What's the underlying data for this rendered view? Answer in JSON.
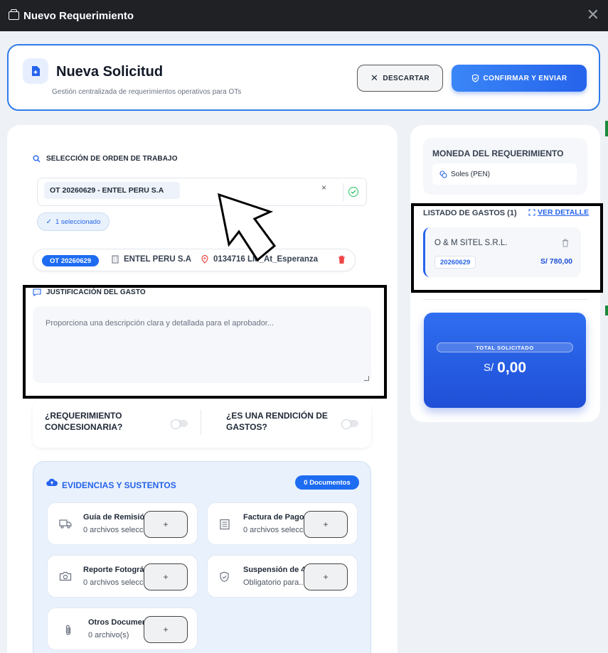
{
  "window": {
    "title": "Nuevo Requerimiento",
    "close_glyph": "✕"
  },
  "header": {
    "title": "Nueva Solicitud",
    "subtitle": "Gestión centralizada de requerimientos operativos para OTs",
    "discard_label": "DESCARTAR",
    "confirm_label": "CONFIRMAR Y ENVIAR"
  },
  "work_order": {
    "section_label": "SELECCIÓN DE ORDEN DE TRABAJO",
    "selected_chip": "OT 20260629 - ENTEL PERU S.A",
    "clear_glyph": "×",
    "selected_count": "1 seleccionado",
    "row": {
      "ot_tag": "OT 20260629",
      "company": "ENTEL PERU S.A",
      "location": "0134716 LM_At_Esperanza"
    }
  },
  "justification": {
    "section_label": "JUSTIFICACIÓN DEL GASTO",
    "placeholder": "Proporciona una descripción clara y detallada para el aprobador..."
  },
  "toggles": [
    {
      "label": "¿REQUERIMIENTO CONCESIONARIA?",
      "on": false
    },
    {
      "label": "¿ES UNA RENDICIÓN DE GASTOS?",
      "on": false
    }
  ],
  "evidence": {
    "title": "EVIDENCIAS Y SUSTENTOS",
    "count_badge": "0 Documentos",
    "add_glyph": "+",
    "docs": [
      {
        "name": "Guía de Remisión",
        "status": "0 archivos seleccionados",
        "icon": "truck-icon"
      },
      {
        "name": "Factura de Pago",
        "status": "0 archivos seleccionados",
        "icon": "invoice-icon"
      },
      {
        "name": "Reporte Fotográfico",
        "status": "0 archivos seleccionados",
        "icon": "camera-icon"
      },
      {
        "name": "Suspensión de 4ta",
        "status": "Obligatorio para...",
        "icon": "shield-icon"
      },
      {
        "name": "Otros Documentos",
        "status": "0 archivo(s)",
        "icon": "paperclip-icon"
      }
    ]
  },
  "currency": {
    "title": "MONEDA DEL REQUERIMIENTO",
    "selected": "Soles (PEN)"
  },
  "expenses": {
    "title": "LISTADO DE GASTOS (1)",
    "detail_link": "VER DETALLE",
    "items": [
      {
        "provider": "O & M SITEL S.R.L.",
        "code": "20260629",
        "amount": "S/ 780,00"
      }
    ]
  },
  "total": {
    "label": "TOTAL SOLICITADO",
    "currency": "S/",
    "amount": "0,00"
  },
  "colors": {
    "accent": "#2563eb",
    "success": "#22c55e",
    "danger": "#ef4444"
  }
}
